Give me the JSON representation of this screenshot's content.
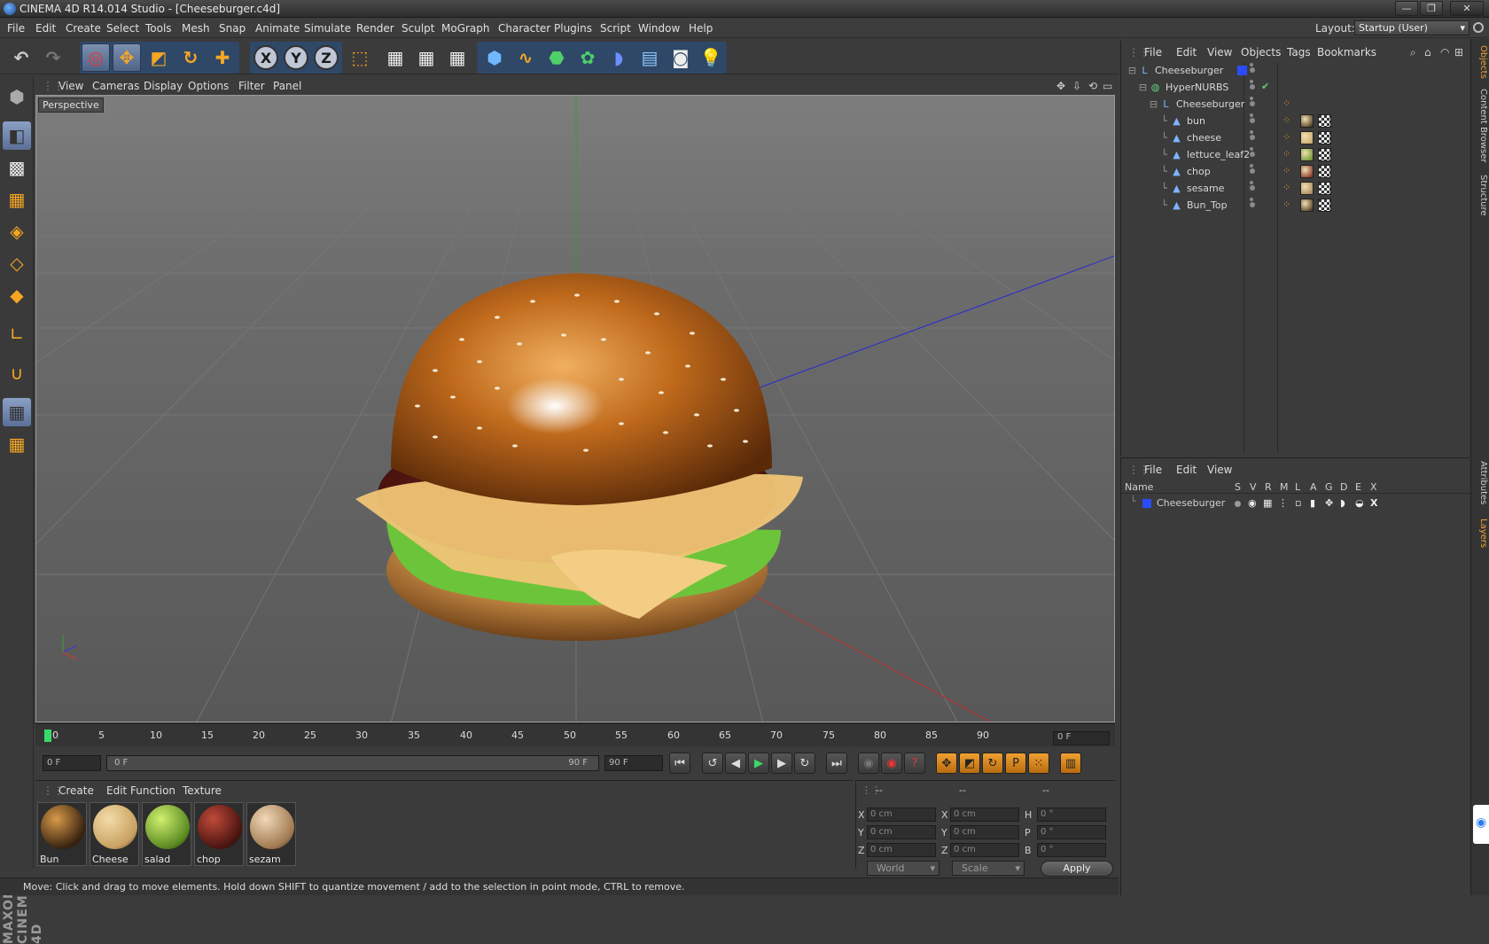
{
  "window": {
    "title": "CINEMA 4D R14.014 Studio - [Cheeseburger.c4d]",
    "min": "—",
    "max": "❐",
    "close": "✕"
  },
  "menubar": [
    "File",
    "Edit",
    "Create",
    "Select",
    "Tools",
    "Mesh",
    "Snap",
    "Animate",
    "Simulate",
    "Render",
    "Sculpt",
    "MoGraph",
    "Character",
    "Plugins",
    "Script",
    "Window",
    "Help"
  ],
  "layout": {
    "label": "Layout:",
    "value": "Startup (User)"
  },
  "toolbar": {
    "x_axis": "X",
    "y_axis": "Y",
    "z_axis": "Z"
  },
  "viewport_menu": [
    "View",
    "Cameras",
    "Display",
    "Options",
    "Filter",
    "Panel"
  ],
  "viewport": {
    "label": "Perspective"
  },
  "timeline": {
    "ticks": [
      "0",
      "5",
      "10",
      "15",
      "20",
      "25",
      "30",
      "35",
      "40",
      "45",
      "50",
      "55",
      "60",
      "65",
      "70",
      "75",
      "80",
      "85",
      "90"
    ],
    "current_frame": "0 F"
  },
  "transport": {
    "start": "0 F",
    "range_start": "0 F",
    "range_end": "90 F",
    "end": "90 F"
  },
  "materials_menu": [
    "Create",
    "Edit",
    "Function",
    "Texture"
  ],
  "materials": [
    {
      "name": "Bun",
      "color": "#3a2410",
      "hi": "#d89a4a"
    },
    {
      "name": "Cheese",
      "color": "#c8a060",
      "hi": "#f3dca8"
    },
    {
      "name": "salad",
      "color": "#5a8a20",
      "hi": "#d0f070"
    },
    {
      "name": "chop",
      "color": "#4a1410",
      "hi": "#c04a3a"
    },
    {
      "name": "sezam",
      "color": "#a07a50",
      "hi": "#f0d8b8"
    }
  ],
  "coords": {
    "headers": [
      "--",
      "--",
      "--"
    ],
    "rows": [
      {
        "a": "X",
        "av": "0 cm",
        "b": "X",
        "bv": "0 cm",
        "c": "H",
        "cv": "0 °"
      },
      {
        "a": "Y",
        "av": "0 cm",
        "b": "Y",
        "bv": "0 cm",
        "c": "P",
        "cv": "0 °"
      },
      {
        "a": "Z",
        "av": "0 cm",
        "b": "Z",
        "bv": "0 cm",
        "c": "B",
        "cv": "0 °"
      }
    ],
    "space": "World",
    "mode": "Scale",
    "apply": "Apply"
  },
  "status": "Move: Click and drag to move elements. Hold down SHIFT to quantize movement / add to the selection in point mode, CTRL to remove.",
  "object_manager": {
    "menu": [
      "File",
      "Edit",
      "View",
      "Objects",
      "Tags",
      "Bookmarks"
    ],
    "objects": [
      {
        "name": "Cheeseburger",
        "indent": 0,
        "icon": "null"
      },
      {
        "name": "HyperNURBS",
        "indent": 1,
        "icon": "nurbs"
      },
      {
        "name": "Cheeseburger",
        "indent": 2,
        "icon": "null"
      },
      {
        "name": "bun",
        "indent": 3,
        "icon": "poly",
        "tag": "#3a2410"
      },
      {
        "name": "cheese",
        "indent": 3,
        "icon": "poly",
        "tag": "#c8a060"
      },
      {
        "name": "lettuce_leaf2",
        "indent": 3,
        "icon": "poly",
        "tag": "#5a8a20"
      },
      {
        "name": "chop",
        "indent": 3,
        "icon": "poly",
        "tag": "#7a1a14"
      },
      {
        "name": "sesame",
        "indent": 3,
        "icon": "poly",
        "tag": "#a07a50"
      },
      {
        "name": "Bun_Top",
        "indent": 3,
        "icon": "poly",
        "tag": "#3a2410"
      }
    ]
  },
  "layer_manager": {
    "menu": [
      "File",
      "Edit",
      "View"
    ],
    "columns": [
      "Name",
      "S",
      "V",
      "R",
      "M",
      "L",
      "A",
      "G",
      "D",
      "E",
      "X"
    ],
    "layers": [
      {
        "name": "Cheeseburger",
        "color": "#2a4cff"
      }
    ]
  },
  "right_tabs": [
    "Objects",
    "Content Browser",
    "Structure",
    "Attributes",
    "Layers"
  ],
  "brand": "MAXON CINEMA 4D"
}
